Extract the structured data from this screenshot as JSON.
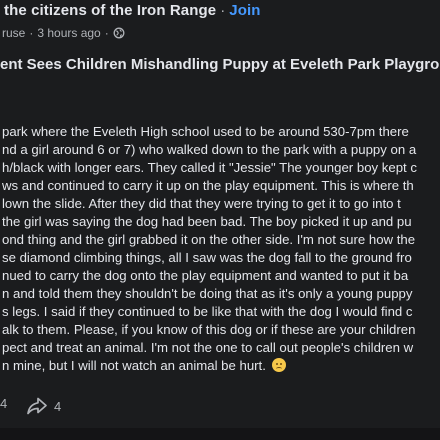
{
  "header": {
    "group_name": "the citizens of the Iron Range",
    "separator": "·",
    "join_label": "Join",
    "author_fragment": "ruse",
    "timestamp": "3 hours ago",
    "meta_separator": "·",
    "audience_icon": "globe-icon"
  },
  "post": {
    "title": "ent Sees Children Mishandling Puppy at Eveleth Park Playgro",
    "lines": [
      "park where the Eveleth High school used to be around 530-7pm there",
      "nd a girl around 6 or 7) who walked down to the park with a puppy on a",
      "h/black with longer ears. They called it \"Jessie\"  The younger boy kept c",
      "ws and continued to carry it up on the play equipment. This is where th",
      "lown the slide. After they did that they were trying to get it to go into t",
      " the girl was saying the dog had been bad. The boy picked it up and pu",
      "ond thing and the girl grabbed it on the other side. I'm not sure how the",
      "se diamond climbing things, all I saw was the dog fall to the ground fro",
      "nued to carry the dog onto the play equipment and wanted to put it ba",
      "n and told them they shouldn't be doing that as it's only a young puppy",
      "s legs. I said if they continued to be like that with the dog I would find c",
      "alk to them. Please, if you know of this dog or if these are your children",
      "pect and treat an animal. I'm not the one to call out people's children w",
      "n mine, but I will not watch an animal be hurt."
    ],
    "emoji": "sad-face-emoji"
  },
  "footer": {
    "comment_count": "4",
    "share_count": "4",
    "share_icon": "share-arrow-icon"
  }
}
